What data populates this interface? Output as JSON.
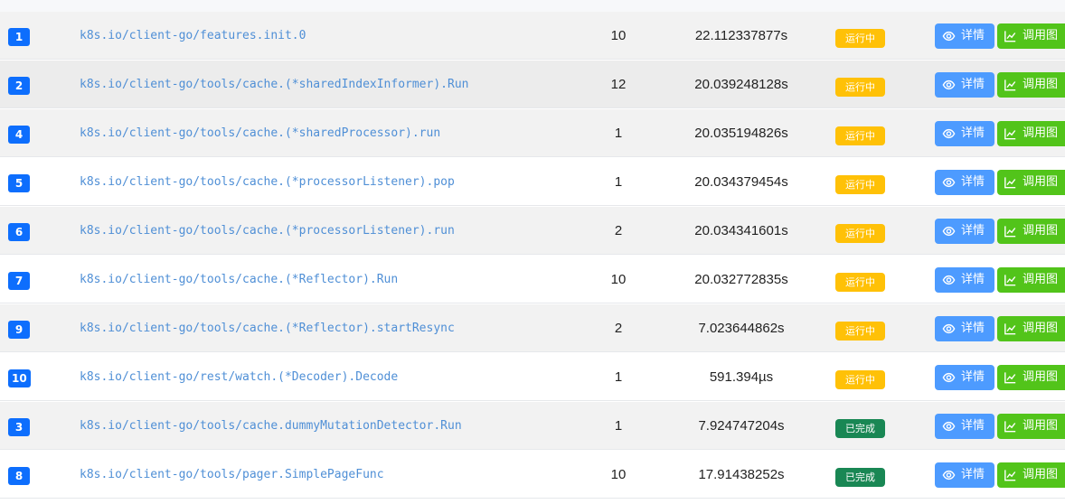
{
  "table": {
    "rows": [
      {
        "id": "1",
        "func": "k8s.io/client-go/features.init.0",
        "count": "10",
        "duration": "22.112337877s",
        "status": "运行中",
        "status_kind": "running"
      },
      {
        "id": "2",
        "func": "k8s.io/client-go/tools/cache.(*sharedIndexInformer).Run",
        "count": "12",
        "duration": "20.039248128s",
        "status": "运行中",
        "status_kind": "running"
      },
      {
        "id": "4",
        "func": "k8s.io/client-go/tools/cache.(*sharedProcessor).run",
        "count": "1",
        "duration": "20.035194826s",
        "status": "运行中",
        "status_kind": "running"
      },
      {
        "id": "5",
        "func": "k8s.io/client-go/tools/cache.(*processorListener).pop",
        "count": "1",
        "duration": "20.034379454s",
        "status": "运行中",
        "status_kind": "running"
      },
      {
        "id": "6",
        "func": "k8s.io/client-go/tools/cache.(*processorListener).run",
        "count": "2",
        "duration": "20.034341601s",
        "status": "运行中",
        "status_kind": "running"
      },
      {
        "id": "7",
        "func": "k8s.io/client-go/tools/cache.(*Reflector).Run",
        "count": "10",
        "duration": "20.032772835s",
        "status": "运行中",
        "status_kind": "running"
      },
      {
        "id": "9",
        "func": "k8s.io/client-go/tools/cache.(*Reflector).startResync",
        "count": "2",
        "duration": "7.023644862s",
        "status": "运行中",
        "status_kind": "running"
      },
      {
        "id": "10",
        "func": "k8s.io/client-go/rest/watch.(*Decoder).Decode",
        "count": "1",
        "duration": "591.394µs",
        "status": "运行中",
        "status_kind": "running"
      },
      {
        "id": "3",
        "func": "k8s.io/client-go/tools/cache.dummyMutationDetector.Run",
        "count": "1",
        "duration": "7.924747204s",
        "status": "已完成",
        "status_kind": "done"
      },
      {
        "id": "8",
        "func": "k8s.io/client-go/tools/pager.SimplePageFunc",
        "count": "10",
        "duration": "17.91438252s",
        "status": "已完成",
        "status_kind": "done"
      }
    ],
    "actions": {
      "detail_label": "详情",
      "detail_icon": "eye-icon",
      "graph_label": "调用图",
      "graph_icon": "line-chart-icon"
    },
    "colors": {
      "id_badge": "#0d6efd",
      "link": "#4f8fd6",
      "running": "#ffc107",
      "done": "#198754",
      "detail_button": "#4d9bff",
      "graph_button": "#52c41a"
    }
  }
}
